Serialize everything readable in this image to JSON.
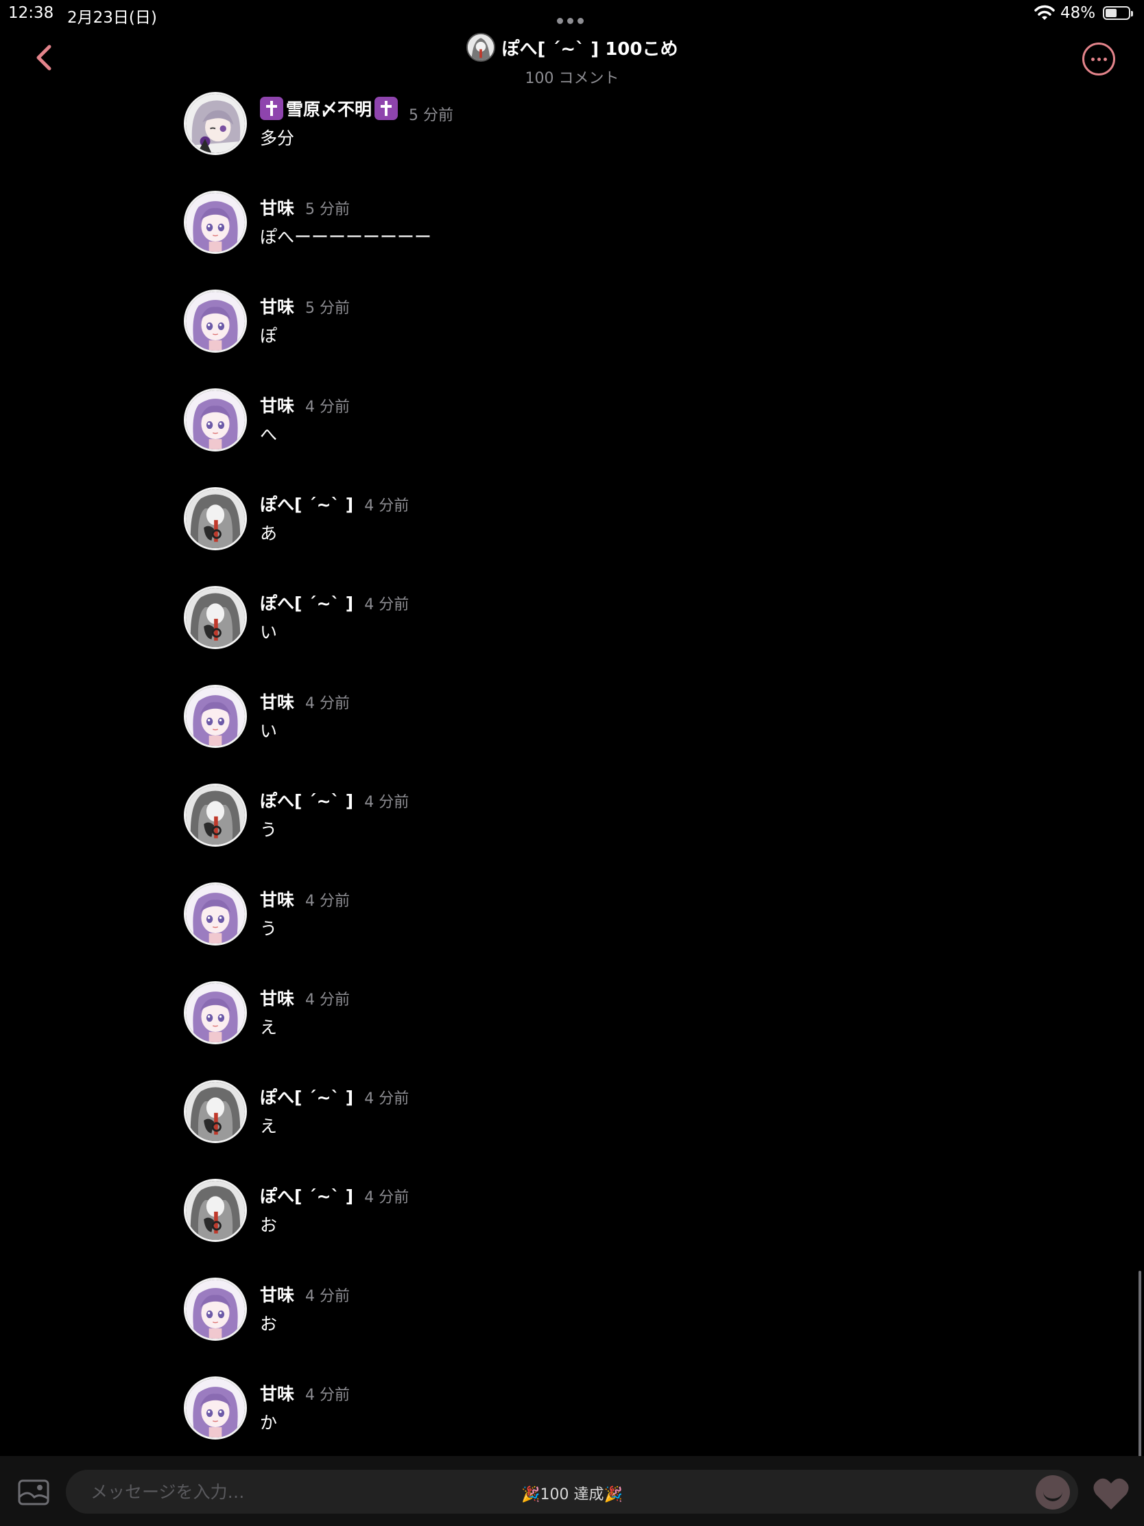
{
  "status_bar": {
    "time": "12:38",
    "date": "2月23日(日)",
    "battery": "48%"
  },
  "header": {
    "title": "ぽへ[ ˊ~ˋ ] 100こめ",
    "subtitle": "100 コメント"
  },
  "comments": [
    {
      "name": "雪原〆不明",
      "time": "5 分前",
      "text": "多分",
      "avatar": "silver-hair"
    },
    {
      "name": "甘味",
      "time": "5 分前",
      "text": "ぽへーーーーーーーー",
      "avatar": "purple-hair"
    },
    {
      "name": "甘味",
      "time": "5 分前",
      "text": "ぽ",
      "avatar": "purple-hair"
    },
    {
      "name": "甘味",
      "time": "4 分前",
      "text": "へ",
      "avatar": "purple-hair"
    },
    {
      "name": "ぽへ[ ˊ~ˋ ]",
      "time": "4 分前",
      "text": "あ",
      "avatar": "monochrome"
    },
    {
      "name": "ぽへ[ ˊ~ˋ ]",
      "time": "4 分前",
      "text": "い",
      "avatar": "monochrome"
    },
    {
      "name": "甘味",
      "time": "4 分前",
      "text": "い",
      "avatar": "purple-hair"
    },
    {
      "name": "ぽへ[ ˊ~ˋ ]",
      "time": "4 分前",
      "text": "う",
      "avatar": "monochrome"
    },
    {
      "name": "甘味",
      "time": "4 分前",
      "text": "う",
      "avatar": "purple-hair"
    },
    {
      "name": "甘味",
      "time": "4 分前",
      "text": "え",
      "avatar": "purple-hair"
    },
    {
      "name": "ぽへ[ ˊ~ˋ ]",
      "time": "4 分前",
      "text": "え",
      "avatar": "monochrome"
    },
    {
      "name": "ぽへ[ ˊ~ˋ ]",
      "time": "4 分前",
      "text": "お",
      "avatar": "monochrome"
    },
    {
      "name": "甘味",
      "time": "4 分前",
      "text": "お",
      "avatar": "purple-hair"
    },
    {
      "name": "甘味",
      "time": "4 分前",
      "text": "か",
      "avatar": "purple-hair"
    }
  ],
  "composer": {
    "placeholder": "メッセージを入力…",
    "badge": "🎉100 達成🎉"
  },
  "colors": {
    "accent": "#e3848b",
    "background": "#000000",
    "muted_text": "#8e8e93"
  }
}
